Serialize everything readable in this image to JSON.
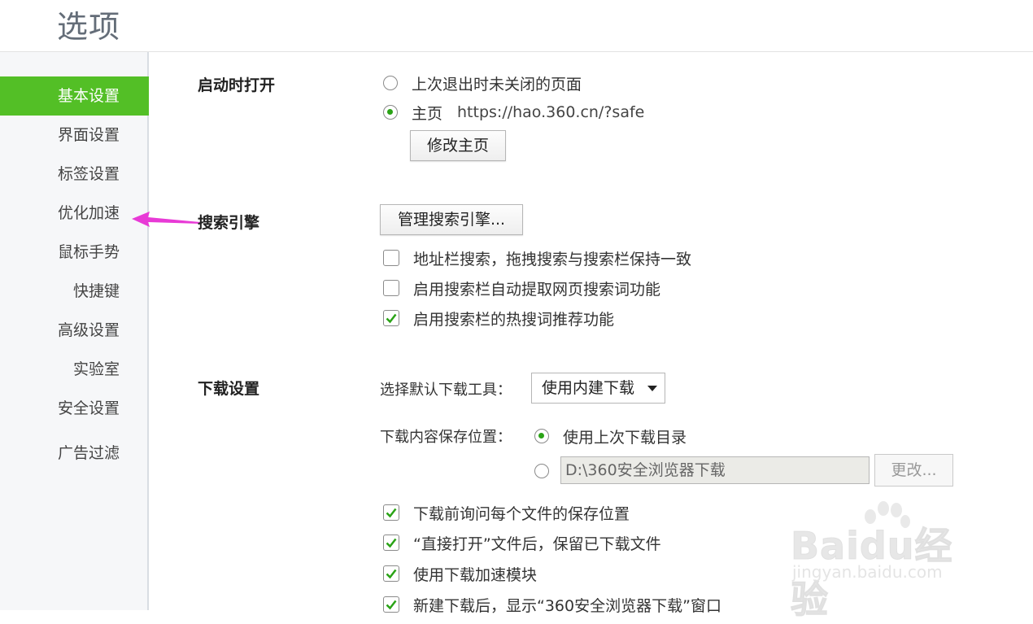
{
  "window": {
    "title": "选项"
  },
  "sidebar": {
    "items": [
      {
        "label": "基本设置",
        "active": true
      },
      {
        "label": "界面设置"
      },
      {
        "label": "标签设置"
      },
      {
        "label": "优化加速"
      },
      {
        "label": "鼠标手势"
      },
      {
        "label": "快捷键"
      },
      {
        "label": "高级设置"
      },
      {
        "label": "实验室"
      },
      {
        "label": "安全设置"
      },
      {
        "label": "广告过滤"
      }
    ]
  },
  "startup": {
    "title": "启动时打开",
    "option_last_session": "上次退出时未关闭的页面",
    "option_homepage": "主页",
    "homepage_url": "https://hao.360.cn/?safe",
    "edit_homepage_button": "修改主页"
  },
  "search": {
    "title": "搜索引擎",
    "manage_button": "管理搜索引擎...",
    "options": [
      {
        "label": "地址栏搜索，拖拽搜索与搜索栏保持一致",
        "checked": false
      },
      {
        "label": "启用搜索栏自动提取网页搜索词功能",
        "checked": false
      },
      {
        "label": "启用搜索栏的热搜词推荐功能",
        "checked": true
      }
    ]
  },
  "download": {
    "title": "下载设置",
    "tool_label": "选择默认下载工具：",
    "tool_value": "使用内建下载",
    "location_label": "下载内容保存位置：",
    "location_last": "使用上次下载目录",
    "path_value": "D:\\360安全浏览器下载",
    "change_button": "更改...",
    "options": [
      {
        "label": "下载前询问每个文件的保存位置",
        "checked": true
      },
      {
        "label": "“直接打开”文件后，保留已下载文件",
        "checked": true
      },
      {
        "label": "使用下载加速模块",
        "checked": true
      },
      {
        "label": "新建下载后，显示“360安全浏览器下载”窗口",
        "checked": true
      }
    ]
  },
  "watermark": {
    "brand": "Baidu经验",
    "url": "jingyan.baidu.com"
  },
  "colors": {
    "accent": "#53bf26",
    "radio_dot": "#2aa316",
    "annotation_arrow": "#e83ad6"
  }
}
